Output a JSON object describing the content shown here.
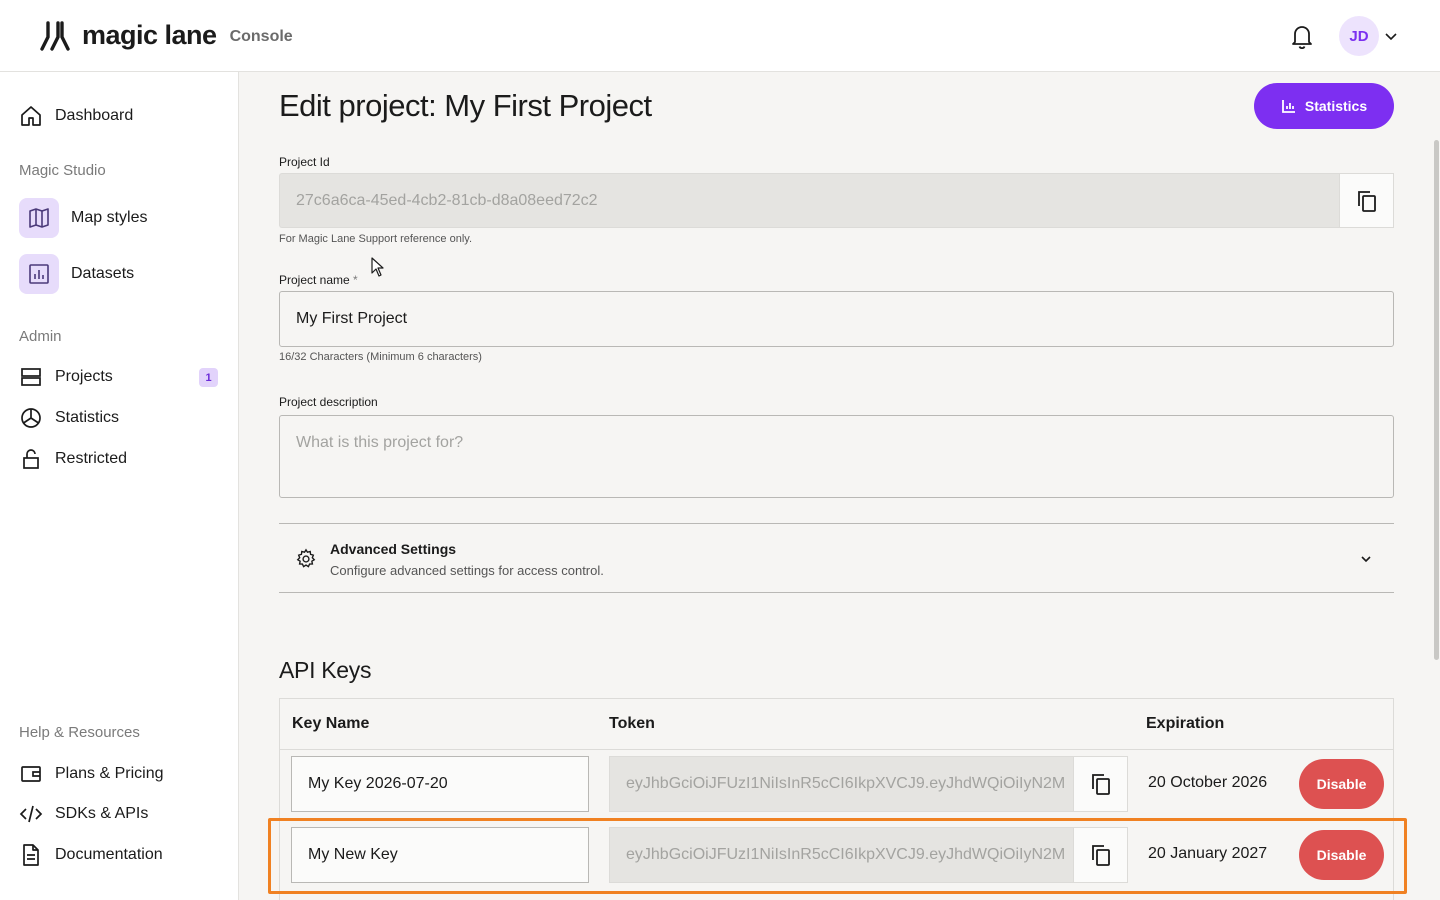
{
  "app": {
    "brand": "magic lane",
    "product": "Console",
    "user_initials": "JD",
    "accent_color": "#7d2ff1"
  },
  "sidebar": {
    "dashboard": "Dashboard",
    "section_studio": "Magic Studio",
    "map_styles": "Map styles",
    "datasets": "Datasets",
    "section_admin": "Admin",
    "projects": "Projects",
    "projects_badge": "1",
    "statistics": "Statistics",
    "restricted": "Restricted",
    "section_help": "Help & Resources",
    "plans": "Plans & Pricing",
    "sdks": "SDKs & APIs",
    "documentation": "Documentation"
  },
  "page": {
    "title": "Edit project: My First Project",
    "statistics_button": "Statistics"
  },
  "form": {
    "project_id_label": "Project Id",
    "project_id_value": "27c6a6ca-45ed-4cb2-81cb-d8a08eed72c2",
    "project_id_help": "For Magic Lane Support reference only.",
    "project_name_label": "Project name",
    "required_mark": "*",
    "project_name_value": "My First Project",
    "project_name_help": "16/32 Characters (Minimum 6 characters)",
    "project_description_label": "Project description",
    "project_description_placeholder": "What is this project for?"
  },
  "advanced": {
    "title": "Advanced Settings",
    "subtitle": "Configure advanced settings for access control."
  },
  "api_keys": {
    "title": "API Keys",
    "columns": {
      "key_name": "Key Name",
      "token": "Token",
      "expiration": "Expiration"
    },
    "rows": [
      {
        "name": "My Key 2026-07-20",
        "token": "eyJhbGciOiJFUzI1NiIsInR5cCI6IkpXVCJ9.eyJhdWQiOiIyN2M",
        "expiration": "20 October 2026",
        "action": "Disable"
      },
      {
        "name": "My New Key",
        "token": "eyJhbGciOiJFUzI1NiIsInR5cCI6IkpXVCJ9.eyJhdWQiOiIyN2M",
        "expiration": "20 January 2027",
        "action": "Disable"
      }
    ]
  }
}
